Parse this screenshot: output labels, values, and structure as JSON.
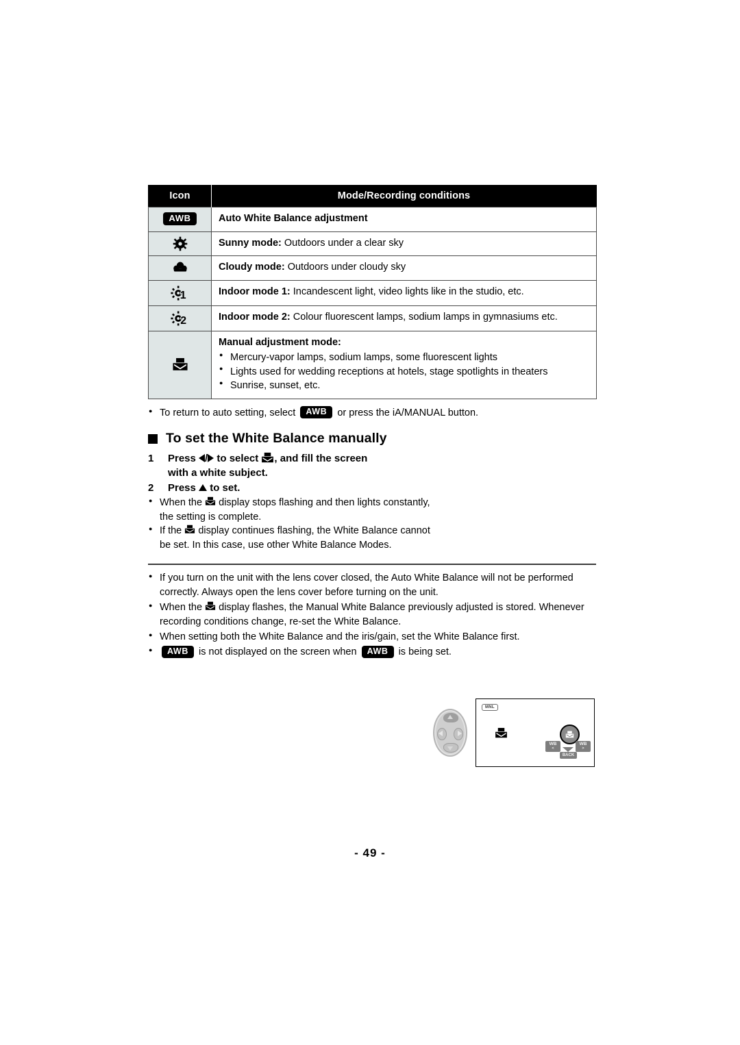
{
  "table": {
    "headers": [
      "Icon",
      "Mode/Recording conditions"
    ],
    "rows": [
      {
        "icon": "awb-badge",
        "icon_label": "AWB",
        "label": "Auto White Balance adjustment",
        "rest": ""
      },
      {
        "icon": "sun-icon",
        "icon_label": "",
        "label": "Sunny mode:",
        "rest": " Outdoors under a clear sky"
      },
      {
        "icon": "cloud-icon",
        "icon_label": "",
        "label": "Cloudy mode:",
        "rest": " Outdoors under cloudy sky"
      },
      {
        "icon": "indoor-1-icon",
        "icon_label": "1",
        "label": "Indoor mode 1:",
        "rest": " Incandescent light, video lights like in the studio, etc."
      },
      {
        "icon": "indoor-2-icon",
        "icon_label": "2",
        "label": "Indoor mode 2:",
        "rest": " Colour fluorescent lamps, sodium lamps in gymnasiums etc."
      },
      {
        "icon": "manual-wb-icon",
        "icon_label": "",
        "label": "Manual adjustment mode:",
        "rest": "",
        "sub_items": [
          "Mercury-vapor lamps, sodium lamps, some fluorescent lights",
          "Lights used for wedding receptions at hotels, stage spotlights in theaters",
          "Sunrise, sunset, etc."
        ]
      }
    ]
  },
  "after_table_note": {
    "part1": "To return to auto setting, select",
    "badge": "AWB",
    "part2": "or press the iA/MANUAL button."
  },
  "section": {
    "title": "To set the White Balance manually",
    "steps": [
      {
        "num": "1",
        "pre": "Press",
        "mid": "to select",
        "post": ", and fill the screen",
        "line2": "with a white subject."
      },
      {
        "num": "2",
        "pre": "Press",
        "post": "to set."
      }
    ],
    "notes": [
      {
        "pre": "When the",
        "post": "display stops flashing and then lights constantly, the setting is complete."
      },
      {
        "pre": "If the",
        "post": "display continues flashing, the White Balance cannot be set. In this case, use other White Balance Modes."
      }
    ]
  },
  "illustration": {
    "mnl_badge": "MNL",
    "osd": {
      "wb_left_label": "WB",
      "wb_left_arrow": "<",
      "wb_right_label": "WB",
      "wb_right_arrow": ">",
      "back_label": "BACK"
    }
  },
  "lower_notes": [
    {
      "type": "plain",
      "text": "If you turn on the unit with the lens cover closed, the Auto White Balance will not be performed correctly. Always open the lens cover before turning on the unit."
    },
    {
      "type": "with-mwb-icon",
      "pre": "When the",
      "post": "display flashes, the Manual White Balance previously adjusted is stored. Whenever recording conditions change, re-set the White Balance."
    },
    {
      "type": "plain",
      "text": "When setting both the White Balance and the iris/gain, set the White Balance first."
    },
    {
      "type": "with-two-awb",
      "badge1": "AWB",
      "mid": "is not displayed on the screen when",
      "badge2": "AWB",
      "end": "is being set."
    }
  ],
  "footer": {
    "page_number": "- 49 -"
  },
  "colors": {
    "header_bg": "#000000",
    "icon_cell_bg": "#dfe6e6",
    "text": "#000000",
    "page_bg": "#ffffff"
  }
}
